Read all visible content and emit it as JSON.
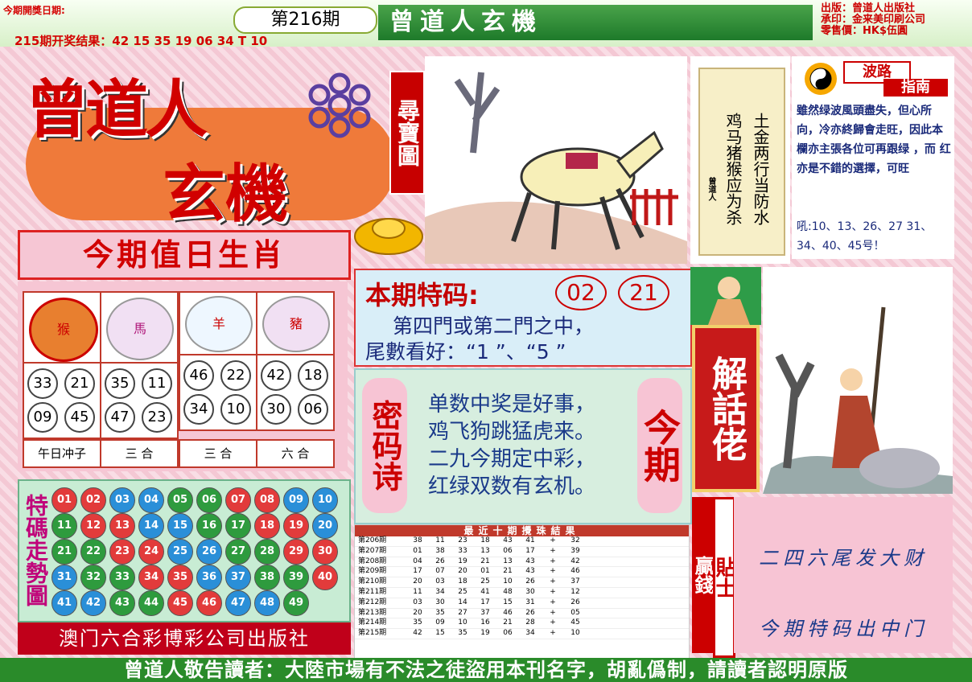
{
  "header": {
    "date_label": "今期開獎日期:",
    "prev_result": "215期开奖结果：42 15 35 19 06 34 T 10",
    "period": "第216期",
    "title": "曾道人玄機",
    "publisher": [
      "出版：曾道人出版社",
      "承印：金来美印刷公司",
      "零售價：HK$伍圓"
    ]
  },
  "brand": {
    "line1": "曾道人",
    "line2": "玄機",
    "tag": "尋寶圖"
  },
  "zodiac_heading": "今期值日生肖",
  "zodiac": [
    {
      "name": "猴",
      "numbers": [
        "33",
        "21",
        "09",
        "45"
      ],
      "label": "午日冲子"
    },
    {
      "name": "馬",
      "numbers": [
        "35",
        "11",
        "47",
        "23"
      ],
      "label": "三 合"
    },
    {
      "name": "羊",
      "numbers": [
        "46",
        "22",
        "34",
        "10"
      ],
      "label": "三 合"
    },
    {
      "name": "豬",
      "numbers": [
        "42",
        "18",
        "30",
        "06"
      ],
      "label": "六 合"
    }
  ],
  "trend": {
    "title": "特碼走勢圖",
    "balls": [
      [
        "01",
        "r"
      ],
      [
        "02",
        "r"
      ],
      [
        "03",
        "b"
      ],
      [
        "04",
        "b"
      ],
      [
        "05",
        "g"
      ],
      [
        "06",
        "g"
      ],
      [
        "07",
        "r"
      ],
      [
        "08",
        "r"
      ],
      [
        "09",
        "b"
      ],
      [
        "10",
        "b"
      ],
      [
        "11",
        "g"
      ],
      [
        "12",
        "r"
      ],
      [
        "13",
        "r"
      ],
      [
        "14",
        "b"
      ],
      [
        "15",
        "b"
      ],
      [
        "16",
        "g"
      ],
      [
        "17",
        "g"
      ],
      [
        "18",
        "r"
      ],
      [
        "19",
        "r"
      ],
      [
        "20",
        "b"
      ],
      [
        "21",
        "g"
      ],
      [
        "22",
        "g"
      ],
      [
        "23",
        "r"
      ],
      [
        "24",
        "r"
      ],
      [
        "25",
        "b"
      ],
      [
        "26",
        "b"
      ],
      [
        "27",
        "g"
      ],
      [
        "28",
        "g"
      ],
      [
        "29",
        "r"
      ],
      [
        "30",
        "r"
      ],
      [
        "31",
        "b"
      ],
      [
        "32",
        "g"
      ],
      [
        "33",
        "g"
      ],
      [
        "34",
        "r"
      ],
      [
        "35",
        "r"
      ],
      [
        "36",
        "b"
      ],
      [
        "37",
        "b"
      ],
      [
        "38",
        "g"
      ],
      [
        "39",
        "g"
      ],
      [
        "40",
        "r"
      ],
      [
        "41",
        "b"
      ],
      [
        "42",
        "b"
      ],
      [
        "43",
        "g"
      ],
      [
        "44",
        "g"
      ],
      [
        "45",
        "r"
      ],
      [
        "46",
        "r"
      ],
      [
        "47",
        "b"
      ],
      [
        "48",
        "b"
      ],
      [
        "49",
        "g"
      ]
    ]
  },
  "footer_publisher": "澳门六合彩博彩公司出版社",
  "special": {
    "label": "本期特码:",
    "n1": "02",
    "n2": "21",
    "line1": "第四門或第二門之中，",
    "line2": "尾數看好：“1 ”、“5 ”"
  },
  "poem": {
    "left": "密码诗",
    "right": "今期",
    "lines": [
      "单数中奖是好事，",
      "鸡飞狗跳猛虎来。",
      "二九今期定中彩，",
      "红绿双数有玄机。"
    ]
  },
  "recent": {
    "title": "最近十期攪珠結果",
    "rows": [
      [
        "第206期",
        "38",
        "11",
        "23",
        "18",
        "43",
        "41",
        "+",
        "32"
      ],
      [
        "第207期",
        "01",
        "38",
        "33",
        "13",
        "06",
        "17",
        "+",
        "39"
      ],
      [
        "第208期",
        "04",
        "26",
        "19",
        "21",
        "13",
        "43",
        "+",
        "42"
      ],
      [
        "第209期",
        "17",
        "07",
        "20",
        "01",
        "21",
        "43",
        "+",
        "46"
      ],
      [
        "第210期",
        "20",
        "03",
        "18",
        "25",
        "10",
        "26",
        "+",
        "37"
      ],
      [
        "第211期",
        "11",
        "34",
        "25",
        "41",
        "48",
        "30",
        "+",
        "12"
      ],
      [
        "第212期",
        "03",
        "30",
        "14",
        "17",
        "15",
        "31",
        "+",
        "26"
      ],
      [
        "第213期",
        "20",
        "35",
        "27",
        "37",
        "46",
        "26",
        "+",
        "05"
      ],
      [
        "第214期",
        "35",
        "09",
        "10",
        "16",
        "21",
        "28",
        "+",
        "45"
      ],
      [
        "第215期",
        "42",
        "15",
        "35",
        "19",
        "06",
        "34",
        "+",
        "10"
      ]
    ]
  },
  "scroll": {
    "col1": "土金两行当防水",
    "col2": "鸡马猪猴应为杀",
    "sig": "曾道人"
  },
  "wave": {
    "title1": "波路",
    "title2": "指南",
    "text": "雖然绿波風頭盡失，但心所向，冷亦終歸會走旺，因此本欄亦主張各位可再跟绿 ，而 红亦是不錯的選擇，可旺",
    "nums": "吼:10、13、26、27  31、34、40、45号！"
  },
  "jiehua": "解話佬",
  "win": {
    "label1": "贏錢",
    "label2": "貼士",
    "tip1": "二四六尾发大财",
    "tip2": "今期特码出中门"
  },
  "bottom": "曾道人敬告讀者：大陸市場有不法之徒盜用本刊名字，胡亂僞制，請讀者認明原版",
  "colors": {
    "red": "#e23b3b",
    "blue": "#2a8fd8",
    "green": "#2e9b3e"
  }
}
